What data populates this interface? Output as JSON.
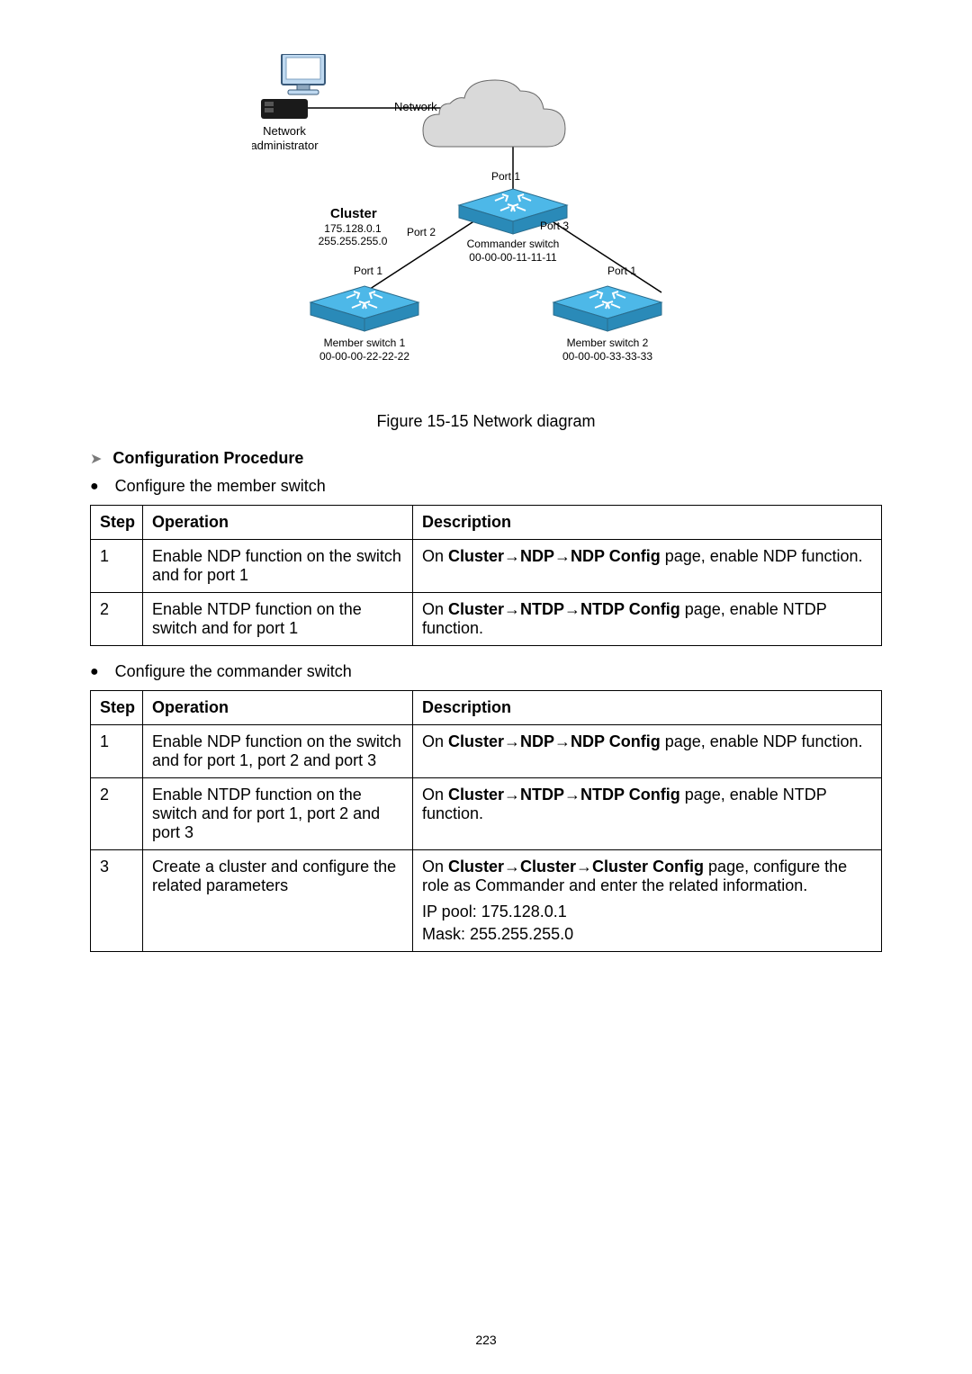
{
  "diagram": {
    "admin_top": "Network",
    "admin_bottom": "administrator",
    "network_cloud": "Network",
    "cluster_title": "Cluster",
    "cluster_ip": "175.128.0.1",
    "cluster_mask": "255.255.255.0",
    "port1_top": "Port 1",
    "port2": "Port 2",
    "port3": "Port 3",
    "port1_left": "Port 1",
    "port1_right": "Port 1",
    "commander_name": "Commander switch",
    "commander_mac": "00-00-00-11-11-11",
    "member1_name": "Member switch 1",
    "member1_mac": "00-00-00-22-22-22",
    "member2_name": "Member switch 2",
    "member2_mac": "00-00-00-33-33-33"
  },
  "caption": "Figure 15-15 Network diagram",
  "section_title": "Configuration Procedure",
  "bullet_member": "Configure the member switch",
  "bullet_commander": "Configure the commander switch",
  "table_headers": {
    "step": "Step",
    "operation": "Operation",
    "description": "Description"
  },
  "member_rows": [
    {
      "step": "1",
      "op": "Enable NDP function on the switch and for port 1",
      "desc_pre": "On ",
      "desc_bold": "Cluster→NDP→NDP Config",
      "desc_post": " page, enable NDP function."
    },
    {
      "step": "2",
      "op": "Enable NTDP function on the switch and for port 1",
      "desc_pre": "On ",
      "desc_bold": "Cluster→NTDP→NTDP Config",
      "desc_post": " page, enable NTDP function."
    }
  ],
  "commander_rows": [
    {
      "step": "1",
      "op": "Enable NDP function on the switch and for port 1, port 2 and port 3",
      "desc_pre": "On ",
      "desc_bold": "Cluster→NDP→NDP Config",
      "desc_post": " page, enable NDP function."
    },
    {
      "step": "2",
      "op": "Enable NTDP function on the switch and for port 1, port 2 and port 3",
      "desc_pre": "On ",
      "desc_bold": "Cluster→NTDP→NTDP Config",
      "desc_post": " page, enable NTDP function."
    },
    {
      "step": "3",
      "op": "Create a cluster and configure the related parameters",
      "desc_pre": "On ",
      "desc_bold": "Cluster→Cluster→Cluster Config",
      "desc_post": " page, configure the role as Commander and enter the related information.",
      "extra1": "IP pool: 175.128.0.1",
      "extra2": "Mask: 255.255.255.0"
    }
  ],
  "page_number": "223"
}
